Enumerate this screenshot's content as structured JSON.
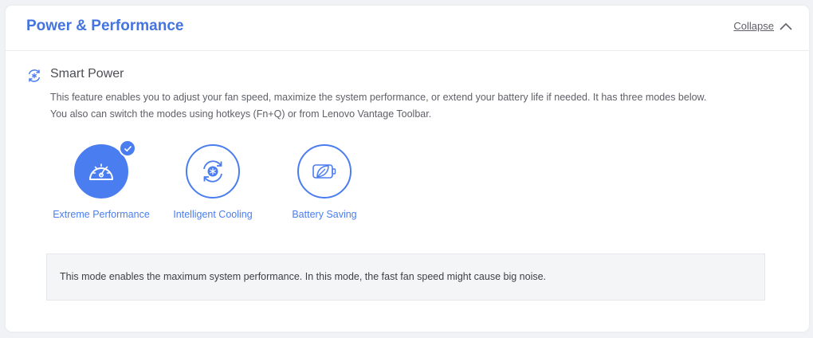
{
  "card": {
    "title": "Power & Performance",
    "collapse_label": "Collapse"
  },
  "smart_power": {
    "icon": "refresh-snowflake-icon",
    "title": "Smart Power",
    "description": "This feature enables you to adjust your fan speed, maximize the system performance, or extend your battery life if needed. It has three modes below. You also can switch the modes using hotkeys (Fn+Q) or from Lenovo Vantage Toolbar."
  },
  "modes": [
    {
      "label": "Extreme Performance",
      "icon": "speedometer-icon",
      "selected": true
    },
    {
      "label": "Intelligent Cooling",
      "icon": "cooling-cycle-icon",
      "selected": false
    },
    {
      "label": "Battery Saving",
      "icon": "leaf-battery-icon",
      "selected": false
    }
  ],
  "mode_description": "This mode enables the maximum system performance. In this mode, the fast fan speed might cause big noise.",
  "colors": {
    "accent": "#4a7df0",
    "title": "#4474e0",
    "info_bg": "#f4f5f7"
  }
}
